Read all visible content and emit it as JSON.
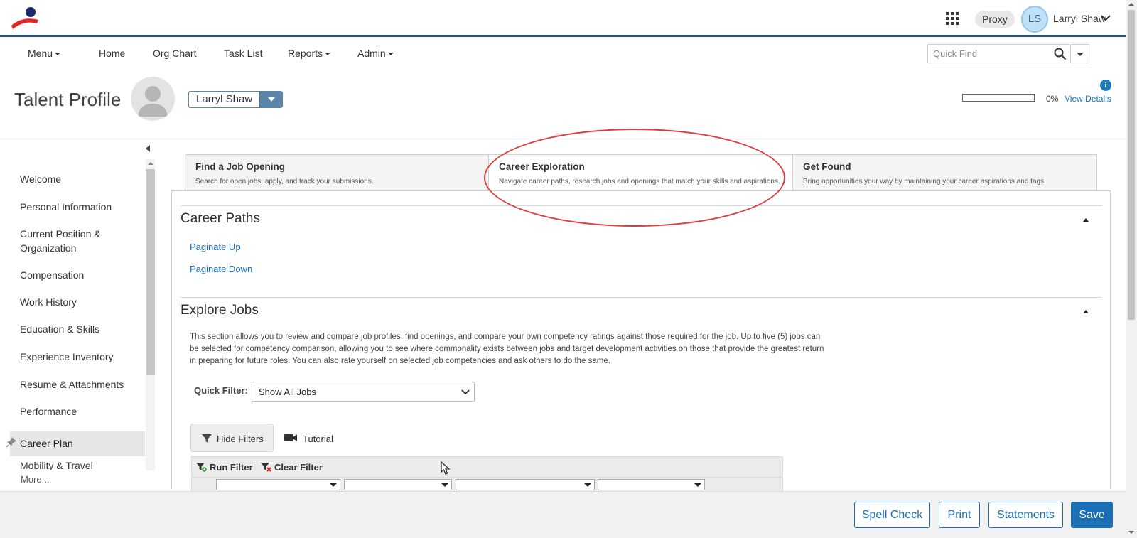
{
  "header": {
    "proxy_label": "Proxy",
    "user_initials": "LS",
    "user_name": "Larryl Shaw"
  },
  "nav": {
    "items": [
      {
        "label": "Menu",
        "has_caret": true
      },
      {
        "label": "Home",
        "has_caret": false
      },
      {
        "label": "Org Chart",
        "has_caret": false
      },
      {
        "label": "Task List",
        "has_caret": false
      },
      {
        "label": "Reports",
        "has_caret": true
      },
      {
        "label": "Admin",
        "has_caret": true
      }
    ],
    "quick_find_placeholder": "Quick Find"
  },
  "profile": {
    "page_title": "Talent Profile",
    "selected_person": "Larryl Shaw",
    "progress_percent": 0,
    "progress_label": "0%",
    "view_details_label": "View Details"
  },
  "sidebar": {
    "items": [
      {
        "label": "Welcome"
      },
      {
        "label": "Personal Information"
      },
      {
        "label": "Current Position & Organization"
      },
      {
        "label": "Compensation"
      },
      {
        "label": "Work History"
      },
      {
        "label": "Education & Skills"
      },
      {
        "label": "Experience Inventory"
      },
      {
        "label": "Resume & Attachments"
      },
      {
        "label": "Performance"
      },
      {
        "label": "Career Plan",
        "active": true
      },
      {
        "label": "Mobility & Travel"
      }
    ],
    "more_label": "More..."
  },
  "tabs": [
    {
      "title": "Find a Job Opening",
      "desc": "Search for open jobs, apply, and track your submissions."
    },
    {
      "title": "Career Exploration",
      "desc": "Navigate career paths, research jobs and openings that match your skills and aspirations.",
      "active": true
    },
    {
      "title": "Get Found",
      "desc": "Bring opportunities your way by maintaining your career aspirations and tags."
    }
  ],
  "career_paths": {
    "title": "Career Paths",
    "paginate_up": "Paginate Up",
    "paginate_down": "Paginate Down"
  },
  "explore_jobs": {
    "title": "Explore Jobs",
    "description": "This section allows you to review and compare job profiles, find openings, and compare your own competency ratings against those required for the job. Up to five (5) jobs can be selected for competency comparison, allowing you to see where commonality exists between jobs and target development activities on those that provide the greatest return in preparing for future roles. You can also rate yourself on selected job competencies and ask others to do the same.",
    "quick_filter_label": "Quick Filter:",
    "quick_filter_value": "Show All Jobs",
    "hide_filters_label": "Hide Filters",
    "tutorial_label": "Tutorial",
    "run_filter_label": "Run Filter",
    "clear_filter_label": "Clear Filter"
  },
  "footer": {
    "spell_check": "Spell Check",
    "print": "Print",
    "statements": "Statements",
    "save": "Save"
  },
  "colors": {
    "brand_blue": "#1a6fb5",
    "header_rule": "#1e4e8c",
    "annotation_red": "#e03a3a"
  },
  "icons": [
    "logo",
    "apps-grid-icon",
    "chevron-down-icon",
    "search-icon",
    "info-icon",
    "person-silhouette-icon",
    "pin-icon",
    "filter-icon",
    "video-camera-icon",
    "run-filter-icon",
    "clear-filter-icon",
    "mouse-cursor-icon"
  ]
}
